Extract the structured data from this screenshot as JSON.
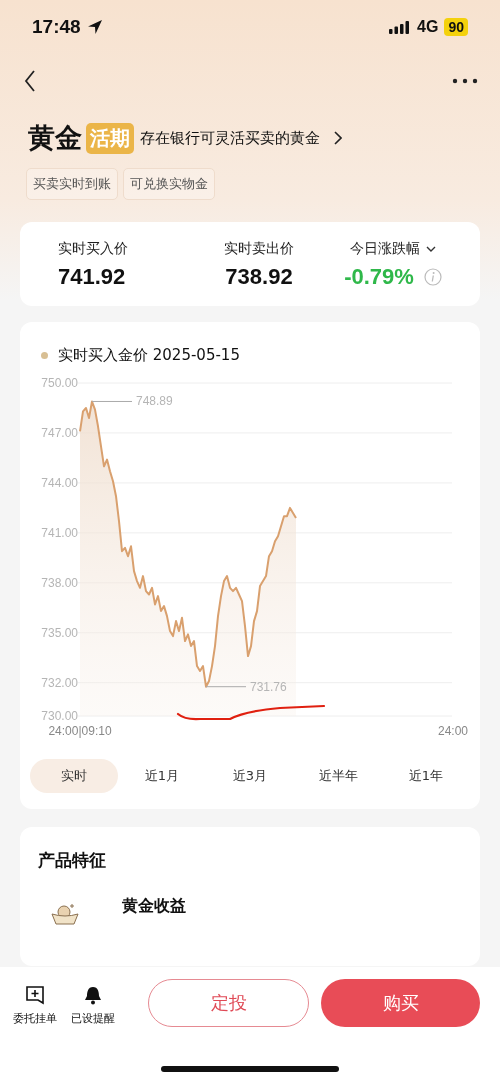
{
  "status_bar": {
    "time": "17:48",
    "network": "4G",
    "battery": "90"
  },
  "header": {
    "title": "黄金",
    "badge": "活期",
    "subtitle": "存在银行可灵活买卖的黄金",
    "tags": [
      "买卖实时到账",
      "可兑换实物金"
    ]
  },
  "prices": [
    {
      "label": "实时买入价",
      "value": "741.92",
      "kind": "plain"
    },
    {
      "label": "实时卖出价",
      "value": "738.92",
      "kind": "plain"
    },
    {
      "label": "今日涨跌幅",
      "value": "-0.79%",
      "kind": "change"
    }
  ],
  "chart": {
    "legend_date": "2025-05-15",
    "x_labels": [
      "24:00|09:10",
      "24:00"
    ],
    "chart_data": {
      "type": "area",
      "grid": true,
      "ylim": [
        730,
        750
      ],
      "yticks": [
        {
          "value": 750,
          "label": "750.00"
        },
        {
          "value": 747,
          "label": "747.00"
        },
        {
          "value": 744,
          "label": "744.00"
        },
        {
          "value": 741,
          "label": "741.00"
        },
        {
          "value": 738,
          "label": "738.00"
        },
        {
          "value": 735,
          "label": "735.00"
        },
        {
          "value": 732,
          "label": "732.00"
        },
        {
          "value": 730,
          "label": "730.00"
        }
      ],
      "series": [
        {
          "name": "实时买入金价",
          "color": "#d9a06e",
          "values": [
            747.1,
            748.3,
            748.5,
            747.9,
            748.89,
            748.4,
            747.4,
            746.2,
            745,
            745.4,
            744.7,
            744.1,
            743.2,
            741.7,
            739.9,
            740.1,
            739.6,
            740.2,
            738.7,
            738.1,
            737.7,
            738.4,
            737.5,
            737.3,
            737.7,
            736.7,
            737.2,
            736.3,
            736.6,
            736,
            735.1,
            734.8,
            735.7,
            735.1,
            735.9,
            734.5,
            734.9,
            734.2,
            734.5,
            733,
            732.7,
            733,
            731.76,
            732.1,
            733,
            734.2,
            736,
            737.2,
            738.1,
            738.4,
            737.7,
            737.5,
            737.7,
            737.3,
            736.9,
            735.4,
            733.6,
            734.2,
            735.7,
            736.3,
            737.8,
            738.1,
            738.4,
            739.6,
            739.9,
            740.5,
            740.8,
            741.4,
            742,
            742,
            742.5,
            742.2,
            741.9
          ]
        }
      ],
      "annotations": [
        "748.89",
        "731.76"
      ]
    },
    "ranges": [
      {
        "label": "实时",
        "selected": true
      },
      {
        "label": "近1月",
        "selected": false
      },
      {
        "label": "近3月",
        "selected": false
      },
      {
        "label": "近半年",
        "selected": false
      },
      {
        "label": "近1年",
        "selected": false
      }
    ]
  },
  "features": {
    "title": "产品特征",
    "items": [
      {
        "title": "黄金收益"
      }
    ]
  },
  "bottom_bar": {
    "actions": [
      {
        "label": "委托挂单",
        "kind": "order"
      },
      {
        "label": "已设提醒",
        "kind": "alert"
      }
    ],
    "buttons": [
      {
        "label": "定投",
        "kind": "outline"
      },
      {
        "label": "购买",
        "kind": "primary"
      }
    ]
  }
}
